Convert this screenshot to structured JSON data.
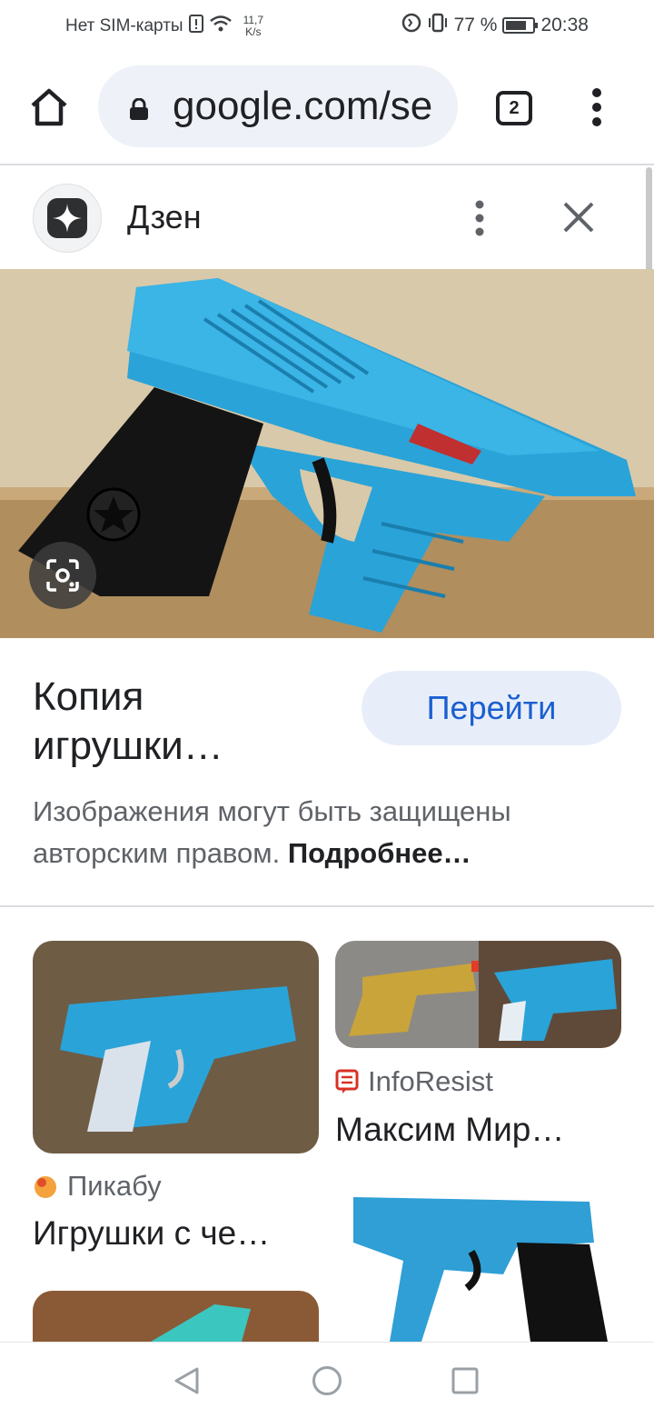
{
  "status_bar": {
    "carrier": "Нет SIM-карты",
    "speed_value": "11,7",
    "speed_unit": "K/s",
    "battery": "77 %",
    "battery_level": 0.77,
    "time": "20:38"
  },
  "browser": {
    "url": "google.com/se",
    "tab_count": "2"
  },
  "source_header": {
    "name": "Дзен"
  },
  "result": {
    "title": "Копия игрушки…",
    "go_button": "Перейти",
    "copyright_text": "Изображения могут быть защищены авторским правом.",
    "more_link": "Подробнее…"
  },
  "related": [
    {
      "source": "Пикабу",
      "title": "Игрушки с че…"
    },
    {
      "source": "InfoResist",
      "title": "Максим Мир…"
    }
  ],
  "colors": {
    "accent": "#1a5fd0",
    "button_bg": "#e8eef9",
    "toy_blue": "#2aa3d8"
  }
}
